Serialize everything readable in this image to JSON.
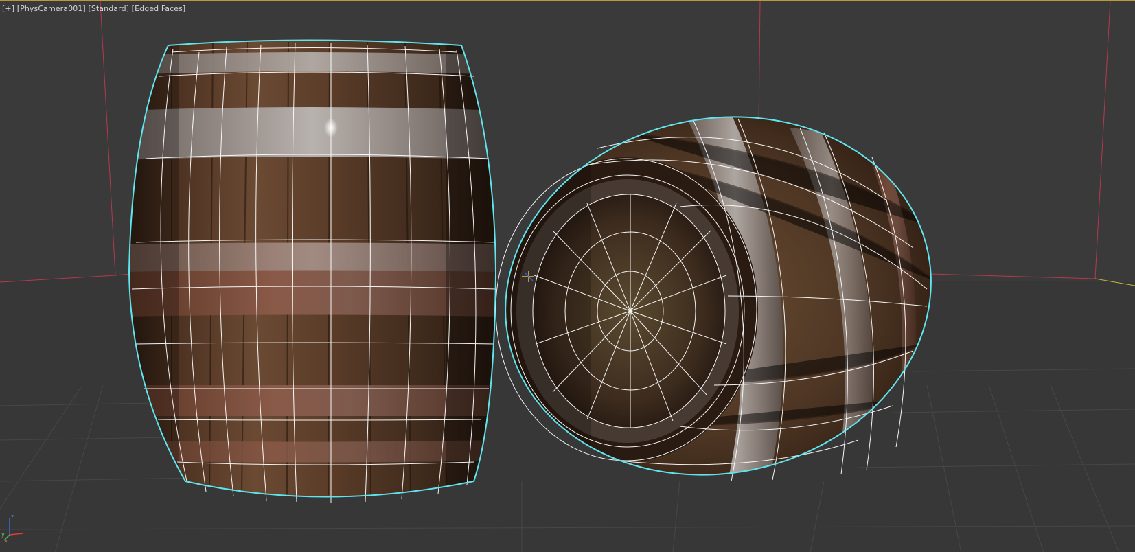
{
  "viewport": {
    "label_plus": "[+]",
    "label_camera": "[PhysCamera001]",
    "label_shading": "[Standard]",
    "label_edged": "[Edged Faces]",
    "background_color": "#3a3a3a",
    "grid_color": "#4a4a4a",
    "selection_color": "#5fe5ef",
    "room_edge_color": "#c0405a",
    "wireframe_color": "#ffffff"
  },
  "gizmo": {
    "axes": [
      "x",
      "y",
      "z"
    ],
    "icon": "axis-tripod-icon"
  },
  "objects": [
    {
      "name": "barrel-upright",
      "material": "wood-barrel-texture",
      "selected": true
    },
    {
      "name": "barrel-lying",
      "material": "wood-barrel-texture",
      "selected": true
    }
  ]
}
